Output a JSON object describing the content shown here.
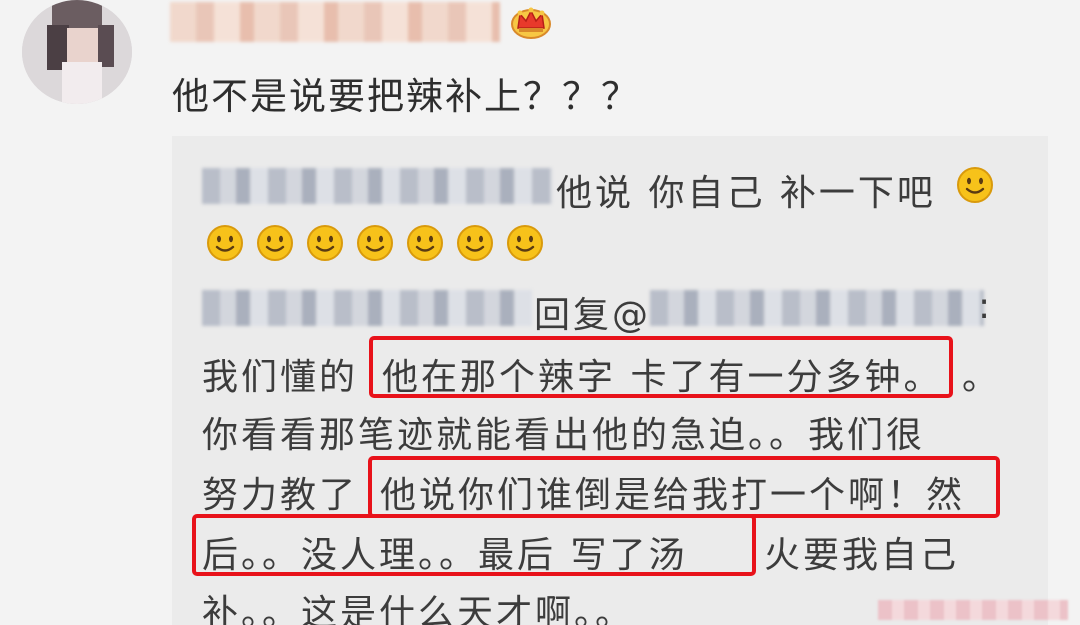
{
  "comment": {
    "text": "他不是说要把辣补上？？？"
  },
  "reply_box": {
    "line1_text": "他说 你自己 补一下吧",
    "reply_prefix": "回复@",
    "reply_colon": ":",
    "body_lines": [
      "我们懂的",
      "他在那个辣字 卡了有一分多钟。",
      "。",
      "你看看那笔迹就能看出他的急迫。。我们很",
      "努力教了",
      "他说你们谁倒是给我打一个啊！然",
      "后。。没人理。。最后 写了汤",
      "火要我自己",
      "补。。这是什么天才啊。。"
    ]
  },
  "icons": {
    "crown": "crown-icon",
    "smiley": "smiley-emoji-icon"
  },
  "colors": {
    "highlight_border": "#e8121a",
    "emoji_yellow": "#f7c21a"
  }
}
